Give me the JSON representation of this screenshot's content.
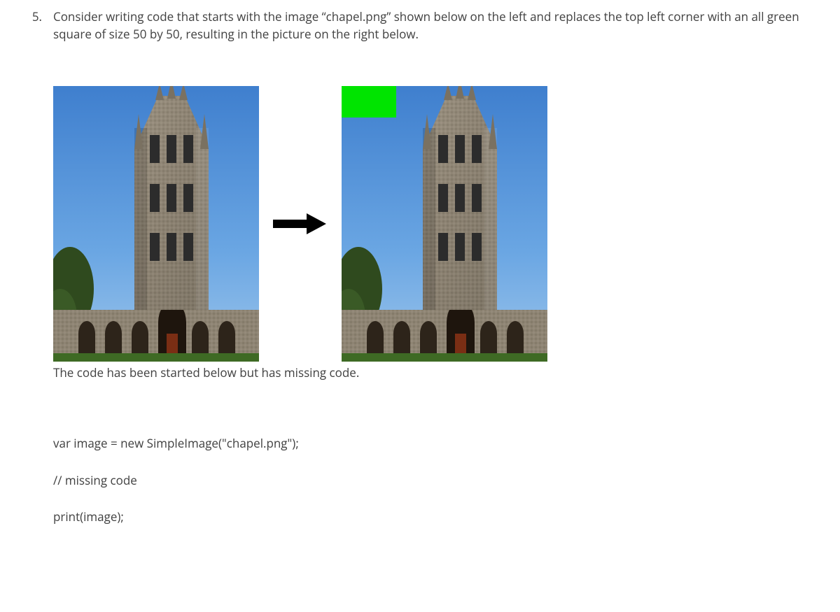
{
  "question": {
    "number": "5.",
    "prompt": "Consider writing code that starts with the image “chapel.png” shown below on the left and replaces the top left corner with an all green square of size 50 by 50, resulting in the picture on the right below."
  },
  "caption": "The code has been started below but has missing code.",
  "code": {
    "line1": "var image = new SimpleImage(\"chapel.png\");",
    "line2": "// missing code",
    "line3": "print(image);"
  },
  "figure": {
    "left_alt": "original chapel image",
    "right_alt": "chapel image with green square in top-left corner",
    "green_square_size": "50 by 50",
    "green_color": "#00e400"
  }
}
